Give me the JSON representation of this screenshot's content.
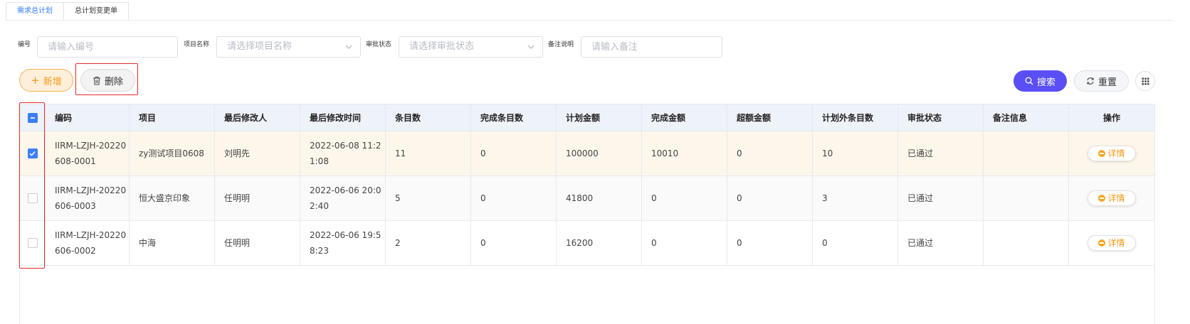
{
  "tabs": [
    {
      "label": "需求总计划",
      "active": true
    },
    {
      "label": "总计划变更单",
      "active": false
    }
  ],
  "filters": {
    "code": {
      "label": "编号",
      "placeholder": "请输入编号"
    },
    "project": {
      "label": "项目名称",
      "placeholder": "请选择项目名称"
    },
    "status": {
      "label": "审批状态",
      "placeholder": "请选择审批状态"
    },
    "remark": {
      "label": "备注说明",
      "placeholder": "请输入备注"
    }
  },
  "toolbar": {
    "add_label": "新增",
    "delete_label": "删除",
    "search_label": "搜索",
    "reset_label": "重置"
  },
  "table": {
    "columns": [
      "编码",
      "项目",
      "最后修改人",
      "最后修改时间",
      "条目数",
      "完成条目数",
      "计划金额",
      "完成金额",
      "超额金额",
      "计划外条目数",
      "审批状态",
      "备注信息",
      "操作"
    ],
    "rows": [
      {
        "checked": true,
        "code": "IIRM-LZJH-20220608-0001",
        "project": "zy测试项目0608",
        "modifier": "刘明先",
        "time": "2022-06-08 11:21:08",
        "items": "11",
        "done_items": "0",
        "plan_amount": "100000",
        "done_amount": "10010",
        "over_amount": "0",
        "extra_items": "10",
        "status": "已通过",
        "remark": "",
        "action": "详情"
      },
      {
        "checked": false,
        "code": "IIRM-LZJH-20220606-0003",
        "project": "恒大盛京印象",
        "modifier": "任明明",
        "time": "2022-06-06 20:02:40",
        "items": "5",
        "done_items": "0",
        "plan_amount": "41800",
        "done_amount": "0",
        "over_amount": "0",
        "extra_items": "3",
        "status": "已通过",
        "remark": "",
        "action": "详情"
      },
      {
        "checked": false,
        "code": "IIRM-LZJH-20220606-0002",
        "project": "中海",
        "modifier": "任明明",
        "time": "2022-06-06 19:58:23",
        "items": "2",
        "done_items": "0",
        "plan_amount": "16200",
        "done_amount": "0",
        "over_amount": "0",
        "extra_items": "0",
        "status": "已通过",
        "remark": "",
        "action": "详情"
      }
    ]
  },
  "colors": {
    "accent": "#2f7cf7",
    "search_button": "#5a4ff4",
    "add_button": "#f39a1b",
    "checkbox": "#3d7ef5",
    "highlight_box": "#e82929"
  }
}
